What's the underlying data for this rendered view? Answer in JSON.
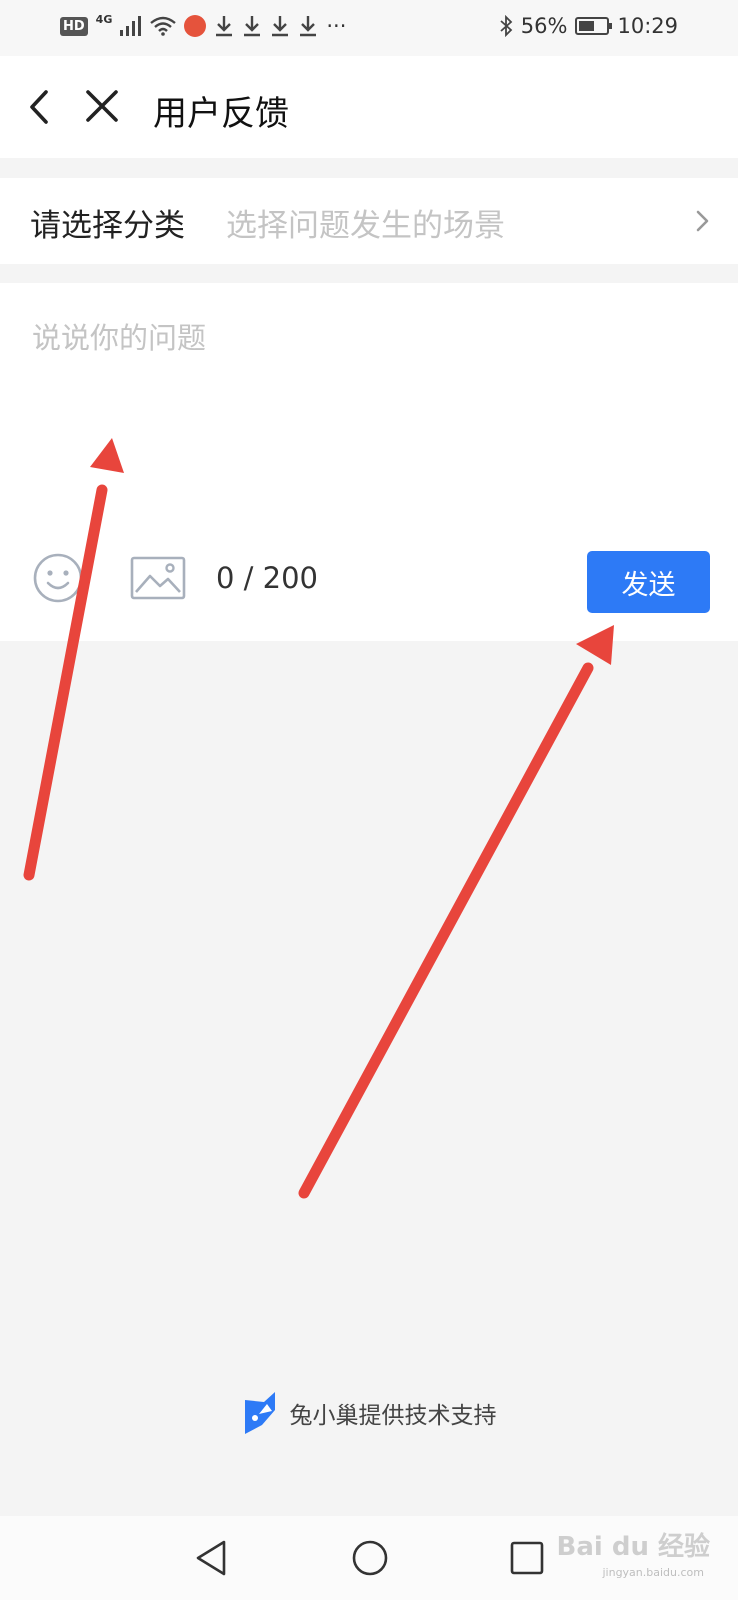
{
  "status_bar": {
    "hd": "HD",
    "network": "4G",
    "more": "···",
    "battery_percent": "56%",
    "battery_level": 0.56,
    "time": "10:29",
    "icons": [
      "signal-icon",
      "wifi-icon",
      "qq-notification-icon",
      "download-icon",
      "bluetooth-icon",
      "battery-icon"
    ]
  },
  "header": {
    "title": "用户反馈",
    "back_icon": "chevron-left-icon",
    "close_icon": "close-icon"
  },
  "category": {
    "label": "请选择分类",
    "placeholder": "选择问题发生的场景"
  },
  "composer": {
    "placeholder": "说说你的问题",
    "value": "",
    "char_count": "0 / 200",
    "send_label": "发送"
  },
  "footer": {
    "powered_by": "兔小巢提供技术支持"
  },
  "watermark": {
    "text": "Bai du 经验",
    "sub": "jingyan.baidu.com"
  },
  "colors": {
    "accent": "#2d7af6",
    "annotation_arrow": "#e8453c",
    "page_background": "#f4f4f4",
    "placeholder_text": "#c4c4c4"
  }
}
